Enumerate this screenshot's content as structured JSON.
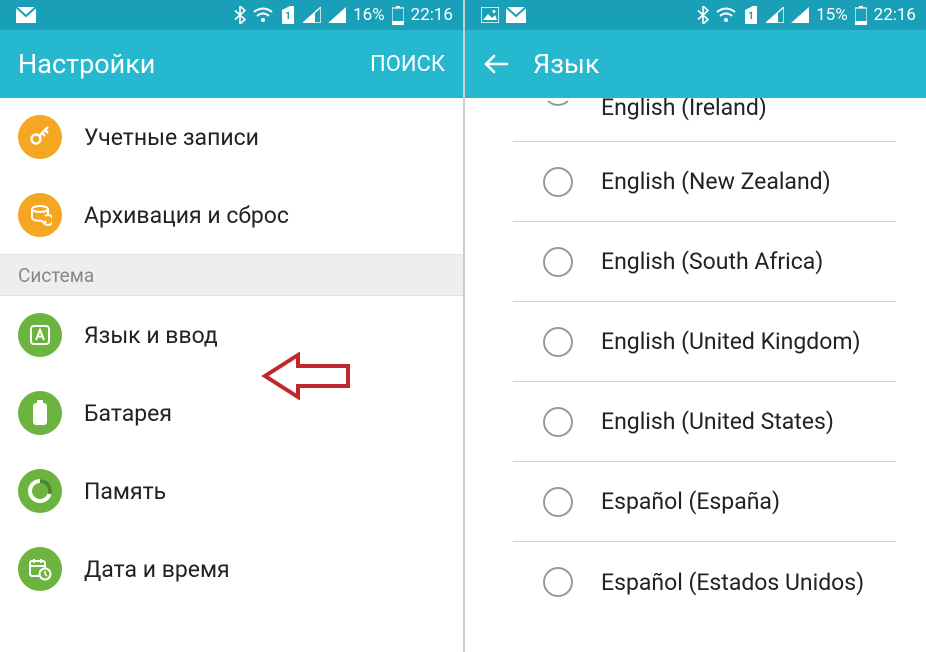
{
  "left": {
    "status": {
      "battery": "16%",
      "time": "22:16"
    },
    "header": {
      "title": "Настройки",
      "action": "ПОИСК"
    },
    "items": [
      {
        "label": "Учетные записи"
      },
      {
        "label": "Архивация и сброс"
      }
    ],
    "section": "Система",
    "system_items": [
      {
        "label": "Язык и ввод"
      },
      {
        "label": "Батарея"
      },
      {
        "label": "Память"
      },
      {
        "label": "Дата и время"
      }
    ]
  },
  "right": {
    "status": {
      "battery": "15%",
      "time": "22:16"
    },
    "header": {
      "title": "Язык"
    },
    "languages": [
      "English (Ireland)",
      "English (New Zealand)",
      "English (South Africa)",
      "English (United Kingdom)",
      "English (United States)",
      "Español (España)",
      "Español (Estados Unidos)"
    ]
  }
}
